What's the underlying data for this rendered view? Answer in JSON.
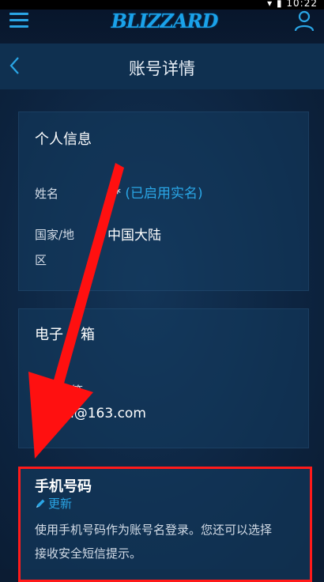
{
  "status": {
    "time": "10:22"
  },
  "header": {
    "logo": "BLIZZARD"
  },
  "subheader": {
    "title": "账号详情"
  },
  "personal": {
    "title": "个人信息",
    "name_label": "姓名",
    "name_value": "**",
    "name_status": "(已启用实名)",
    "region_label_line1": "国家/地",
    "region_label_line2": "区",
    "region_value": "中国大陆"
  },
  "email": {
    "title_part1": "电子",
    "title_part2": "箱",
    "label_part": "箱",
    "value": "**l@163.com"
  },
  "phone": {
    "title": "手机号码",
    "update_label": "更新",
    "description_line1": "使用手机号码作为账号名登录。您还可以选择",
    "description_line2": "接收安全短信提示。"
  },
  "colors": {
    "accent": "#2aa6e6",
    "highlight": "#ff1a1a",
    "background": "#0c1c33"
  }
}
